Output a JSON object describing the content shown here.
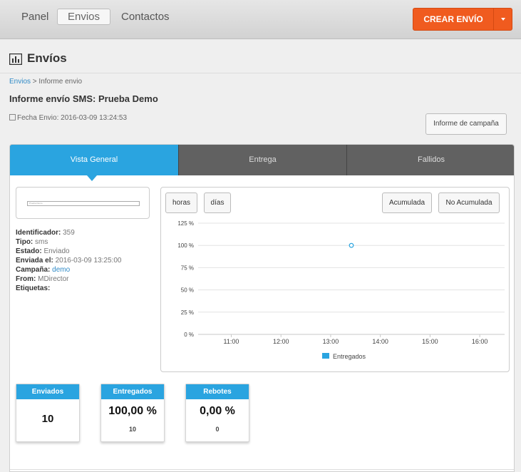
{
  "nav": {
    "items": [
      "Panel",
      "Envios",
      "Contactos"
    ],
    "create_label": "CREAR ENVÍO"
  },
  "page": {
    "title": "Envíos"
  },
  "breadcrumb": {
    "link": "Envios",
    "current": "> Informe envio"
  },
  "report": {
    "title": "Informe envío SMS: Prueba Demo",
    "date_text": "Fecha Envio: 2016-03-09 13:24:53",
    "campaign_button": "Informe de campaña"
  },
  "tabs": [
    "Vista General",
    "Entrega",
    "Fallidos"
  ],
  "preview": {
    "text": "Prueba Demo"
  },
  "meta": [
    {
      "label": "Identificador:",
      "value": "359"
    },
    {
      "label": "Tipo:",
      "value": "sms"
    },
    {
      "label": "Estado:",
      "value": "Enviado"
    },
    {
      "label": "Enviada el:",
      "value": "2016-03-09 13:25:00"
    },
    {
      "label": "Campaña:",
      "value": "demo"
    },
    {
      "label": "From:",
      "value": "MDirector"
    },
    {
      "label": "Etiquetas:",
      "value": ""
    }
  ],
  "chart_controls": {
    "horas": "horas",
    "dias": "días",
    "acumulada": "Acumulada",
    "no_acumulada": "No Acumulada"
  },
  "chart_data": {
    "type": "line",
    "x_ticks": [
      "11:00",
      "12:00",
      "13:00",
      "14:00",
      "15:00",
      "16:00"
    ],
    "y_ticks": [
      "125 %",
      "100 %",
      "75 %",
      "50 %",
      "25 %",
      "0 %"
    ],
    "ylim": [
      0,
      125
    ],
    "xlim": [
      "10:20",
      "16:30"
    ],
    "grid": true,
    "legend_position": "bottom",
    "series": [
      {
        "name": "Entregados",
        "color": "#2aa4e0",
        "points": [
          {
            "x": "13:25",
            "y": 100
          }
        ]
      }
    ]
  },
  "stats": [
    {
      "title": "Enviados",
      "value": "10",
      "sub": ""
    },
    {
      "title": "Entregados",
      "value": "100,00 %",
      "sub": "10"
    },
    {
      "title": "Rebotes",
      "value": "0,00 %",
      "sub": "0"
    }
  ],
  "colors": {
    "accent": "#2aa4e0",
    "create_button": "#f05b1f",
    "tab_bar": "#616161"
  }
}
